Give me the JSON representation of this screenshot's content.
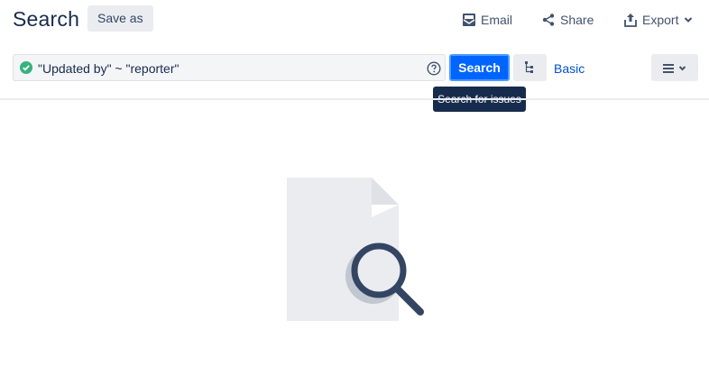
{
  "header": {
    "title": "Search",
    "save_as_label": "Save as",
    "email_label": "Email",
    "share_label": "Share",
    "export_label": "Export"
  },
  "query": {
    "text": "\"Updated by\" ~ \"reporter\"",
    "status_icon": "check-circle-icon",
    "help_icon": "question-circle-icon"
  },
  "toolbar": {
    "search_label": "Search",
    "basic_label": "Basic",
    "structure_icon": "hierarchy-icon",
    "menu_icon": "list-menu-icon"
  },
  "tooltip": {
    "text": "Search for issues"
  },
  "colors": {
    "primary": "#0065ff",
    "link": "#0052cc",
    "success": "#36b37e",
    "text": "#172b4d",
    "subtle_bg": "#ebecf0"
  }
}
